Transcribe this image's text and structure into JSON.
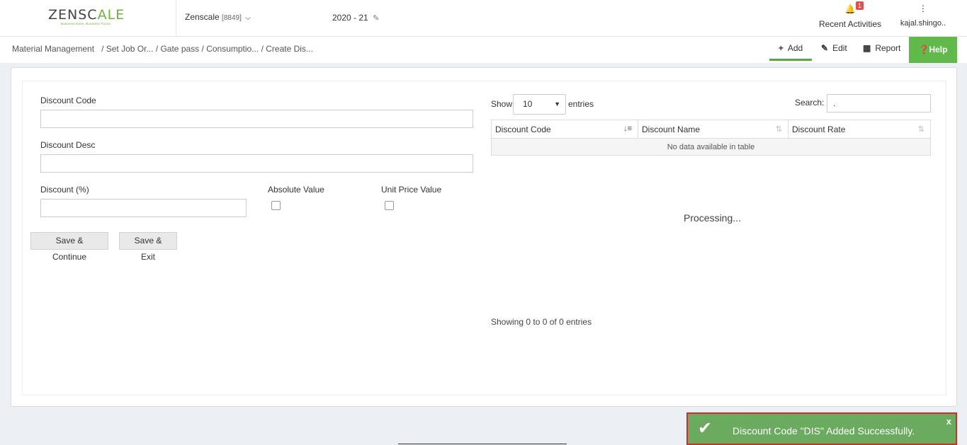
{
  "header": {
    "logo_prefix": "ZENSC",
    "logo_accent": "A",
    "logo_suffix": "LE",
    "logo_tagline": "Business Ease, Business Focus",
    "company_name": "Zenscale",
    "company_code": "[8849]",
    "year": "2020 - 21",
    "recent_label": "Recent Activities",
    "notification_count": "1",
    "user_name": "kajal.shingo.."
  },
  "breadcrumb": {
    "items": [
      "Material Management",
      "Set Job Or...",
      "Gate pass",
      "Consumptio...",
      "Create Dis..."
    ]
  },
  "toolbar": {
    "add_label": "Add",
    "edit_label": "Edit",
    "report_label": "Report",
    "help_label": "Help"
  },
  "form": {
    "discount_code_label": "Discount Code",
    "discount_desc_label": "Discount Desc",
    "discount_pct_label": "Discount (%)",
    "absolute_value_label": "Absolute Value",
    "unit_price_value_label": "Unit Price Value",
    "save_continue_label": "Save & Continue",
    "save_exit_label": "Save & Exit"
  },
  "table": {
    "show_label": "Show",
    "entries_value": "10",
    "entries_label": "entries",
    "search_label": "Search:",
    "search_value": ".",
    "columns": [
      "Discount Code",
      "Discount Name",
      "Discount Rate"
    ],
    "empty_message": "No data available in table",
    "processing_label": "Processing...",
    "info": "Showing 0 to 0 of 0 entries"
  },
  "toast": {
    "message": "Discount Code \"DIS\" Added Successfully.",
    "close_label": "x"
  },
  "colors": {
    "accent_green": "#61b94c",
    "toast_bg": "#6bab5f",
    "toast_border": "#d42a2a",
    "badge_red": "#d9534f"
  }
}
